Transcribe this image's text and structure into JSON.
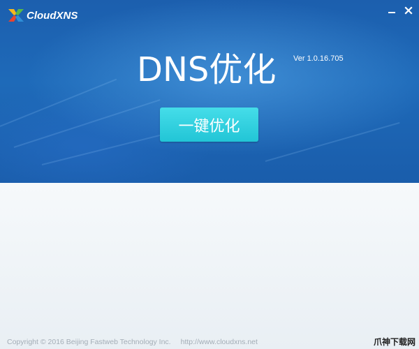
{
  "app": {
    "logo_text": "CloudXNS",
    "title": "DNS优化",
    "version": "Ver 1.0.16.705"
  },
  "window_controls": {
    "minimize_symbol": "–",
    "close_symbol": "✕"
  },
  "main": {
    "optimize_button_label": "一键优化"
  },
  "footer": {
    "copyright": "Copyright © 2016 Beijing Fastweb Technology Inc.",
    "url": "http://www.cloudxns.net"
  },
  "watermark": {
    "text": "爪神下载网"
  },
  "colors": {
    "banner": "#1c5fae",
    "button": "#2fd1df",
    "lower_bg": "#eef2f6"
  }
}
